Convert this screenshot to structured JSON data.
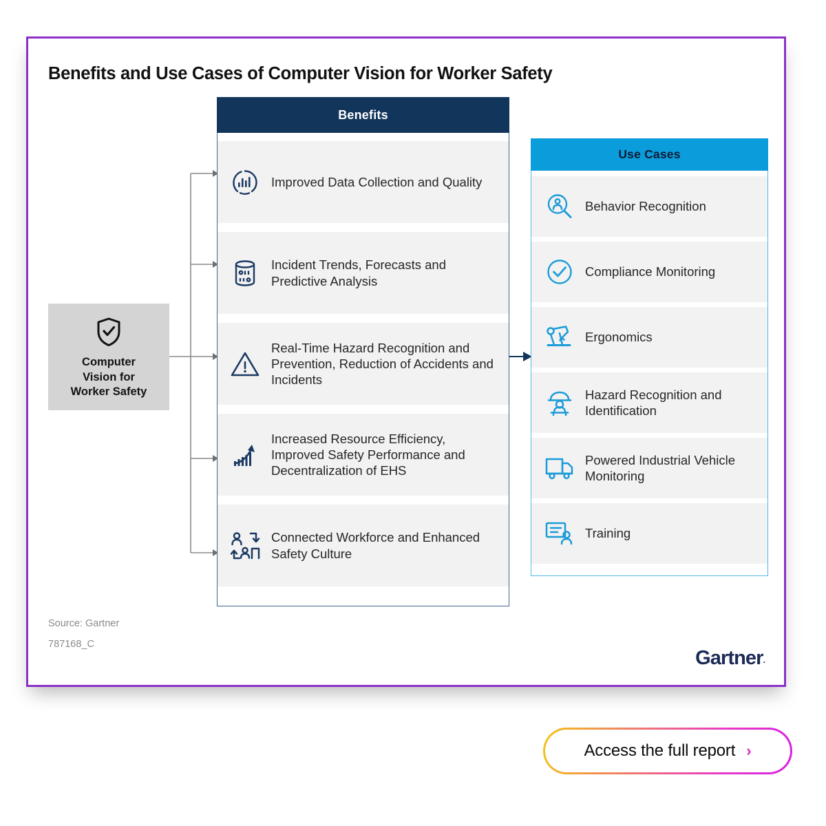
{
  "title": "Benefits and Use Cases of Computer Vision for Worker Safety",
  "source_box": {
    "icon": "shield-check-icon",
    "label": "Computer\nVision for\nWorker Safety",
    "line1": "Computer",
    "line2": "Vision for",
    "line3": "Worker Safety",
    "background": "#d4d4d4"
  },
  "benefits": {
    "header": "Benefits",
    "header_color": "#12355b",
    "border_color": "#3d6490",
    "items": [
      {
        "icon": "data-chart-circle-icon",
        "label": "Improved Data Collection and Quality"
      },
      {
        "icon": "database-cylinder-icon",
        "label": "Incident Trends, Forecasts and Predictive Analysis"
      },
      {
        "icon": "warning-triangle-icon",
        "label": "Real-Time Hazard Recognition and Prevention, Reduction of Accidents and Incidents"
      },
      {
        "icon": "growth-arrow-bar-icon",
        "label": "Increased Resource Efficiency, Improved Safety Performance and Decentralization of EHS"
      },
      {
        "icon": "connected-workforce-icon",
        "label": "Connected Workforce and Enhanced Safety Culture"
      }
    ]
  },
  "use_cases": {
    "header": "Use Cases",
    "header_color": "#0b9ddb",
    "border_color": "#4fb8e8",
    "items": [
      {
        "icon": "person-magnifier-icon",
        "label": "Behavior Recognition"
      },
      {
        "icon": "check-circle-icon",
        "label": "Compliance Monitoring"
      },
      {
        "icon": "robotic-arm-icon",
        "label": "Ergonomics"
      },
      {
        "icon": "hazard-person-icon",
        "label": "Hazard Recognition and Identification"
      },
      {
        "icon": "truck-icon",
        "label": "Powered Industrial Vehicle Monitoring"
      },
      {
        "icon": "training-board-icon",
        "label": "Training"
      }
    ]
  },
  "footer": {
    "source": "Source: Gartner",
    "doc_id": "787168_C",
    "logo": "Gartner",
    "logo_mark": "."
  },
  "cta": {
    "label": "Access the full report",
    "chevron": "›",
    "chevron_color": "#e020c8"
  },
  "theme": {
    "card_border": "#8b2fc9",
    "row_background": "#f2f2f2",
    "navy": "#12355b",
    "blue": "#0b9ddb",
    "connector": "#8a8a8a"
  }
}
